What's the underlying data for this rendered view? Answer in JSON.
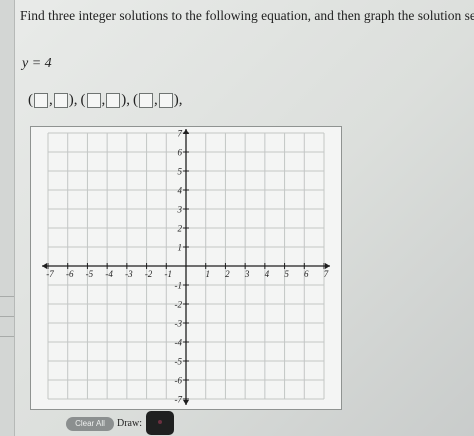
{
  "question": {
    "prompt": "Find three integer solutions to the following equation, and then graph the solution set.",
    "equation": "y = 4"
  },
  "answer_blanks": {
    "open_paren": "(",
    "comma": ",",
    "close_paren_sep": "),",
    "pairs_count_label": "3",
    "pairs": [
      {
        "x": "",
        "y": ""
      },
      {
        "x": "",
        "y": ""
      },
      {
        "x": "",
        "y": ""
      }
    ]
  },
  "graph": {
    "x_range": [
      -7,
      7
    ],
    "y_range": [
      -7,
      7
    ],
    "x_tick_labels": [
      "-7",
      "-6",
      "-5",
      "-4",
      "-3",
      "-2",
      "-1",
      "1",
      "2",
      "3",
      "4",
      "5",
      "6",
      "7"
    ],
    "y_tick_labels": [
      "7",
      "6",
      "5",
      "4",
      "3",
      "2",
      "1",
      "-1",
      "-2",
      "-3",
      "-4",
      "-5",
      "-6",
      "-7"
    ],
    "grid": true
  },
  "toolbar": {
    "clear_all_label": "Clear All",
    "draw_label": "Draw:",
    "draw_tool_icon": "point-dot-icon"
  },
  "colors": {
    "grid_line": "#c3c6c5",
    "axis": "#1f1f1f",
    "button_bg": "#8b8f8f",
    "draw_tool_bg": "#1f2020",
    "draw_dot": "#6b2f3f"
  }
}
